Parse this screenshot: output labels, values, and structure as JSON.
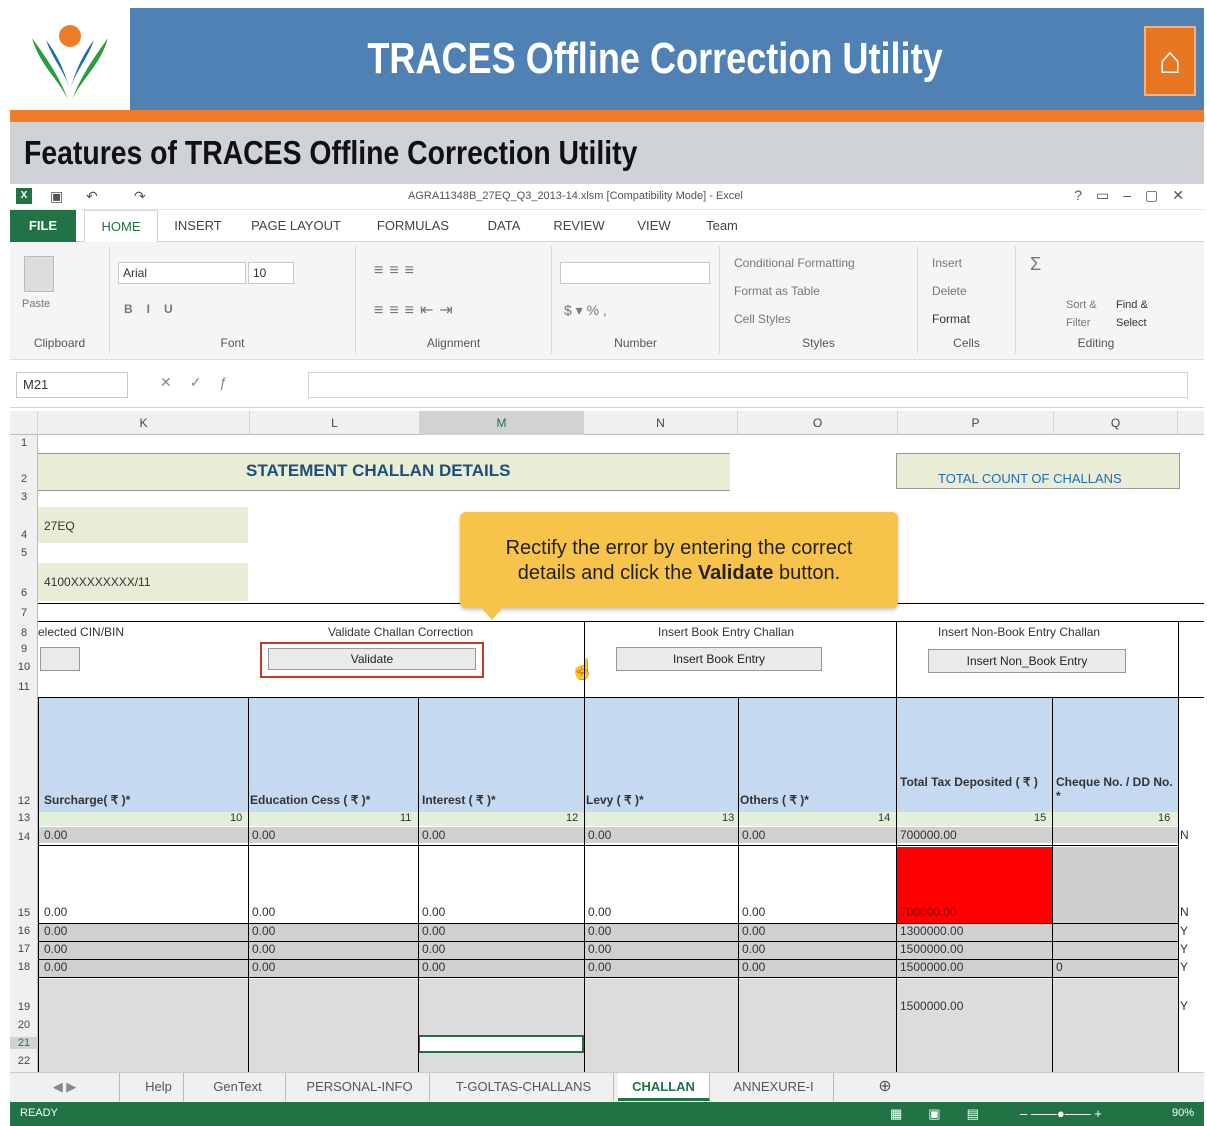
{
  "banner": {
    "title": "TRACES Offline Correction Utility"
  },
  "subtitle": "Features of TRACES Offline Correction Utility",
  "excel": {
    "window_title": "AGRA11348B_27EQ_Q3_2013-14.xlsm  [Compatibility Mode] - Excel",
    "tabs": [
      "FILE",
      "HOME",
      "INSERT",
      "PAGE LAYOUT",
      "FORMULAS",
      "DATA",
      "REVIEW",
      "VIEW",
      "Team"
    ],
    "ribbon": {
      "font_name": "Arial",
      "font_size": "10",
      "groups": [
        "Clipboard",
        "Font",
        "Alignment",
        "Number",
        "Styles",
        "Cells",
        "Editing"
      ],
      "paste": "Paste",
      "styles": [
        "Conditional Formatting",
        "Format as Table",
        "Cell Styles"
      ],
      "cells": [
        "Insert",
        "Delete",
        "Format"
      ],
      "editing": [
        "Sort & Filter",
        "Find & Select"
      ]
    },
    "name_box": "M21",
    "columns": [
      "K",
      "L",
      "M",
      "N",
      "O",
      "P",
      "Q"
    ],
    "rows": [
      "1",
      "2",
      "3",
      "4",
      "5",
      "6",
      "7",
      "8",
      "9",
      "10",
      "11",
      "12",
      "13",
      "14",
      "15",
      "16",
      "17",
      "18",
      "19",
      "20",
      "21",
      "22"
    ],
    "sheet": {
      "statement_title": "STATEMENT CHALLAN DETAILS",
      "total_count_label": "TOTAL COUNT OF CHALLANS",
      "form": "27EQ",
      "tan": "4100XXXXXXXX/11",
      "selected_cin": "elected CIN/BIN",
      "validate_section": "Validate Challan Correction",
      "validate_btn": "Validate",
      "insert_book_section": "Insert Book Entry Challan",
      "insert_book_btn": "Insert Book Entry",
      "insert_nonbook_section": "Insert Non-Book Entry Challan",
      "insert_nonbook_btn": "Insert Non_Book Entry",
      "headers": [
        "Surcharge( ₹ )*",
        "Education Cess ( ₹ )*",
        "Interest ( ₹ )*",
        "Levy ( ₹ )*",
        "Others ( ₹ )*",
        "Total Tax Deposited ( ₹ )",
        "Cheque No. / DD No. *"
      ],
      "col_numbers": [
        "10",
        "11",
        "12",
        "13",
        "14",
        "15",
        "16"
      ],
      "data_rows": [
        {
          "row": "14",
          "vals": [
            "0.00",
            "0.00",
            "0.00",
            "0.00",
            "0.00",
            "700000.00",
            ""
          ],
          "flag": "N"
        },
        {
          "row": "15",
          "vals": [
            "0.00",
            "0.00",
            "0.00",
            "0.00",
            "0.00",
            "700000.00",
            ""
          ],
          "flag": "N"
        },
        {
          "row": "16",
          "vals": [
            "0.00",
            "0.00",
            "0.00",
            "0.00",
            "0.00",
            "1300000.00",
            ""
          ],
          "flag": "Y"
        },
        {
          "row": "17",
          "vals": [
            "0.00",
            "0.00",
            "0.00",
            "0.00",
            "0.00",
            "1500000.00",
            ""
          ],
          "flag": "Y"
        },
        {
          "row": "18",
          "vals": [
            "0.00",
            "0.00",
            "0.00",
            "0.00",
            "0.00",
            "1500000.00",
            "0"
          ],
          "flag": "Y"
        },
        {
          "row": "19",
          "vals": [
            "",
            "",
            "",
            "",
            "",
            "1500000.00",
            ""
          ],
          "flag": "Y"
        }
      ]
    },
    "sheet_tabs": [
      "Help",
      "GenText",
      "PERSONAL-INFO",
      "T-GOLTAS-CHALLANS",
      "CHALLAN",
      "ANNEXURE-I"
    ],
    "active_sheet": "CHALLAN",
    "status": "READY",
    "zoom": "90%"
  },
  "callout": {
    "line1": "Rectify the error by entering the correct",
    "line2_pre": "details and click the ",
    "line2_bold": "Validate",
    "line2_post": " button."
  },
  "colors": {
    "banner": "#4f81b4",
    "accent": "#f07c28",
    "excel_green": "#217346",
    "header_band": "#c5d9f1",
    "error": "#ff0000"
  }
}
